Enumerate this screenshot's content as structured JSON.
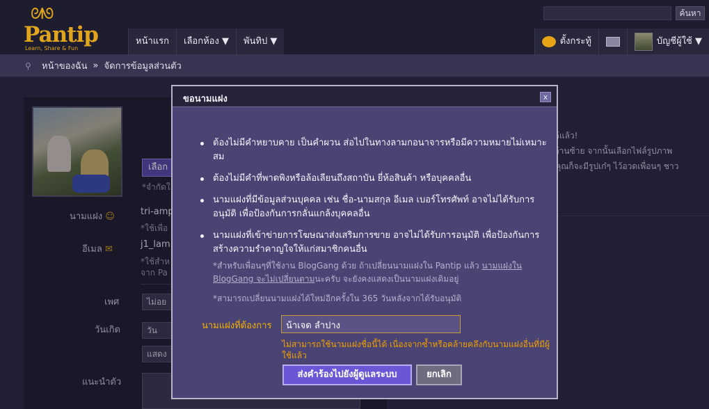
{
  "header": {
    "logo_text": "Pantip",
    "logo_tagline": "Learn, Share & Fun",
    "search_placeholder": "",
    "search_button": "ค้นหา",
    "nav": [
      "หน้าแรก",
      "เลือกห้อง ▼",
      "พันทิป ▼"
    ],
    "nav_right": {
      "post": "ตั้งกระทู้",
      "account": "บัญชีผู้ใช้ ▼"
    }
  },
  "breadcrumb": {
    "home": "หน้าของฉัน",
    "separator": "»",
    "current": "จัดการข้อมูลส่วนตัว"
  },
  "background_form": {
    "choose_button": "เลือก",
    "choose_hint": "*จำกัดใ",
    "nickname_label": "นามแฝง",
    "nickname_value": "tri-amp",
    "nickname_hint": "*ใช้เพื่อ",
    "email_label": "อีเมล",
    "email_value": "j1_lam",
    "email_hint_1": "*ใช้สำห",
    "email_hint_2": "จาก Pa",
    "gender_label": "เพศ",
    "gender_value": "ไม่อย",
    "birthday_label": "วันเกิด",
    "birthday_day": "วัน",
    "birthday_show": "แสดง",
    "about_label": "แนะนำตัว",
    "right_line_1": "ได้แล้ว!",
    "right_line_2": "งด้านซ้าย จากนั้นเลือกไฟล์รูปภาพ",
    "right_line_3": "นี้คุณก็จะมีรูปเก๋ๆ ไว้อวดเพื่อนๆ ชาว"
  },
  "modal": {
    "title": "ขอนามแฝง",
    "close_label": "x",
    "rules": [
      "ต้องไม่มีคำหยาบคาย เป็นคำผวน ส่อไปในทางลามกอนาจารหรือมีความหมายไม่เหมาะสม",
      "ต้องไม่มีคำที่พาดพิงหรือล้อเลียนถึงสถาบัน ยี่ห้อสินค้า หรือบุคคลอื่น",
      "นามแฝงที่มีข้อมูลส่วนบุคคล เช่น ชื่อ-นามสกุล อีเมล เบอร์โทรศัพท์ อาจไม่ได้รับการอนุมัติ เพื่อป้องกันการกลั่นแกล้งบุคคลอื่น",
      "นามแฝงที่เข้าข่ายการโฆษณาส่งเสริมการขาย อาจไม่ได้รับการอนุมัติ เพื่อป้องกันการสร้างความรำคาญใจให้แก่สมาชิกคนอื่น"
    ],
    "note_1_prefix": "*สำหรับเพื่อนๆที่ใช้งาน BlogGang ด้วย ถ้าเปลี่ยนนามแฝงใน Pantip แล้ว ",
    "note_1_link": "นามแฝงใน BlogGang จะไม่เปลี่ยนตาม",
    "note_1_suffix": "นะครับ จะยังคงแสดงเป็นนามแฝงเดิมอยู่",
    "note_2": "*สามารถเปลี่ยนนามแฝงได้ใหม่อีกครั้งใน 365 วันหลังจากได้รับอนุมัติ",
    "field_label": "นามแฝงที่ต้องการ",
    "field_value": "น้าเจด ลำปาง",
    "error": "ไม่สามารถใช้นามแฝงชื่อนี้ได้ เนื่องจากซ้ำหรือคล้ายคลึงกับนามแฝงอื่นที่มีผู้ใช้แล้ว",
    "submit_button": "ส่งคำร้องไปยังผู้ดูแลระบบ",
    "cancel_button": "ยกเลิก"
  },
  "colors": {
    "accent": "#e0a51c",
    "modal_bg": "#494474",
    "error": "#f0a000",
    "primary_button": "#6b56d6"
  }
}
